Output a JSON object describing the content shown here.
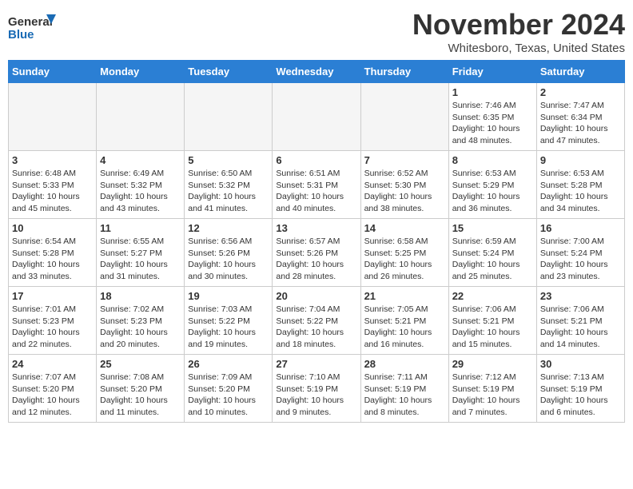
{
  "header": {
    "logo_line1": "General",
    "logo_line2": "Blue",
    "month": "November 2024",
    "location": "Whitesboro, Texas, United States"
  },
  "weekdays": [
    "Sunday",
    "Monday",
    "Tuesday",
    "Wednesday",
    "Thursday",
    "Friday",
    "Saturday"
  ],
  "weeks": [
    [
      {
        "day": "",
        "empty": true
      },
      {
        "day": "",
        "empty": true
      },
      {
        "day": "",
        "empty": true
      },
      {
        "day": "",
        "empty": true
      },
      {
        "day": "",
        "empty": true
      },
      {
        "day": "1",
        "sunrise": "7:46 AM",
        "sunset": "6:35 PM",
        "daylight": "10 hours and 48 minutes."
      },
      {
        "day": "2",
        "sunrise": "7:47 AM",
        "sunset": "6:34 PM",
        "daylight": "10 hours and 47 minutes."
      }
    ],
    [
      {
        "day": "3",
        "sunrise": "6:48 AM",
        "sunset": "5:33 PM",
        "daylight": "10 hours and 45 minutes."
      },
      {
        "day": "4",
        "sunrise": "6:49 AM",
        "sunset": "5:32 PM",
        "daylight": "10 hours and 43 minutes."
      },
      {
        "day": "5",
        "sunrise": "6:50 AM",
        "sunset": "5:32 PM",
        "daylight": "10 hours and 41 minutes."
      },
      {
        "day": "6",
        "sunrise": "6:51 AM",
        "sunset": "5:31 PM",
        "daylight": "10 hours and 40 minutes."
      },
      {
        "day": "7",
        "sunrise": "6:52 AM",
        "sunset": "5:30 PM",
        "daylight": "10 hours and 38 minutes."
      },
      {
        "day": "8",
        "sunrise": "6:53 AM",
        "sunset": "5:29 PM",
        "daylight": "10 hours and 36 minutes."
      },
      {
        "day": "9",
        "sunrise": "6:53 AM",
        "sunset": "5:28 PM",
        "daylight": "10 hours and 34 minutes."
      }
    ],
    [
      {
        "day": "10",
        "sunrise": "6:54 AM",
        "sunset": "5:28 PM",
        "daylight": "10 hours and 33 minutes."
      },
      {
        "day": "11",
        "sunrise": "6:55 AM",
        "sunset": "5:27 PM",
        "daylight": "10 hours and 31 minutes."
      },
      {
        "day": "12",
        "sunrise": "6:56 AM",
        "sunset": "5:26 PM",
        "daylight": "10 hours and 30 minutes."
      },
      {
        "day": "13",
        "sunrise": "6:57 AM",
        "sunset": "5:26 PM",
        "daylight": "10 hours and 28 minutes."
      },
      {
        "day": "14",
        "sunrise": "6:58 AM",
        "sunset": "5:25 PM",
        "daylight": "10 hours and 26 minutes."
      },
      {
        "day": "15",
        "sunrise": "6:59 AM",
        "sunset": "5:24 PM",
        "daylight": "10 hours and 25 minutes."
      },
      {
        "day": "16",
        "sunrise": "7:00 AM",
        "sunset": "5:24 PM",
        "daylight": "10 hours and 23 minutes."
      }
    ],
    [
      {
        "day": "17",
        "sunrise": "7:01 AM",
        "sunset": "5:23 PM",
        "daylight": "10 hours and 22 minutes."
      },
      {
        "day": "18",
        "sunrise": "7:02 AM",
        "sunset": "5:23 PM",
        "daylight": "10 hours and 20 minutes."
      },
      {
        "day": "19",
        "sunrise": "7:03 AM",
        "sunset": "5:22 PM",
        "daylight": "10 hours and 19 minutes."
      },
      {
        "day": "20",
        "sunrise": "7:04 AM",
        "sunset": "5:22 PM",
        "daylight": "10 hours and 18 minutes."
      },
      {
        "day": "21",
        "sunrise": "7:05 AM",
        "sunset": "5:21 PM",
        "daylight": "10 hours and 16 minutes."
      },
      {
        "day": "22",
        "sunrise": "7:06 AM",
        "sunset": "5:21 PM",
        "daylight": "10 hours and 15 minutes."
      },
      {
        "day": "23",
        "sunrise": "7:06 AM",
        "sunset": "5:21 PM",
        "daylight": "10 hours and 14 minutes."
      }
    ],
    [
      {
        "day": "24",
        "sunrise": "7:07 AM",
        "sunset": "5:20 PM",
        "daylight": "10 hours and 12 minutes."
      },
      {
        "day": "25",
        "sunrise": "7:08 AM",
        "sunset": "5:20 PM",
        "daylight": "10 hours and 11 minutes."
      },
      {
        "day": "26",
        "sunrise": "7:09 AM",
        "sunset": "5:20 PM",
        "daylight": "10 hours and 10 minutes."
      },
      {
        "day": "27",
        "sunrise": "7:10 AM",
        "sunset": "5:19 PM",
        "daylight": "10 hours and 9 minutes."
      },
      {
        "day": "28",
        "sunrise": "7:11 AM",
        "sunset": "5:19 PM",
        "daylight": "10 hours and 8 minutes."
      },
      {
        "day": "29",
        "sunrise": "7:12 AM",
        "sunset": "5:19 PM",
        "daylight": "10 hours and 7 minutes."
      },
      {
        "day": "30",
        "sunrise": "7:13 AM",
        "sunset": "5:19 PM",
        "daylight": "10 hours and 6 minutes."
      }
    ]
  ]
}
